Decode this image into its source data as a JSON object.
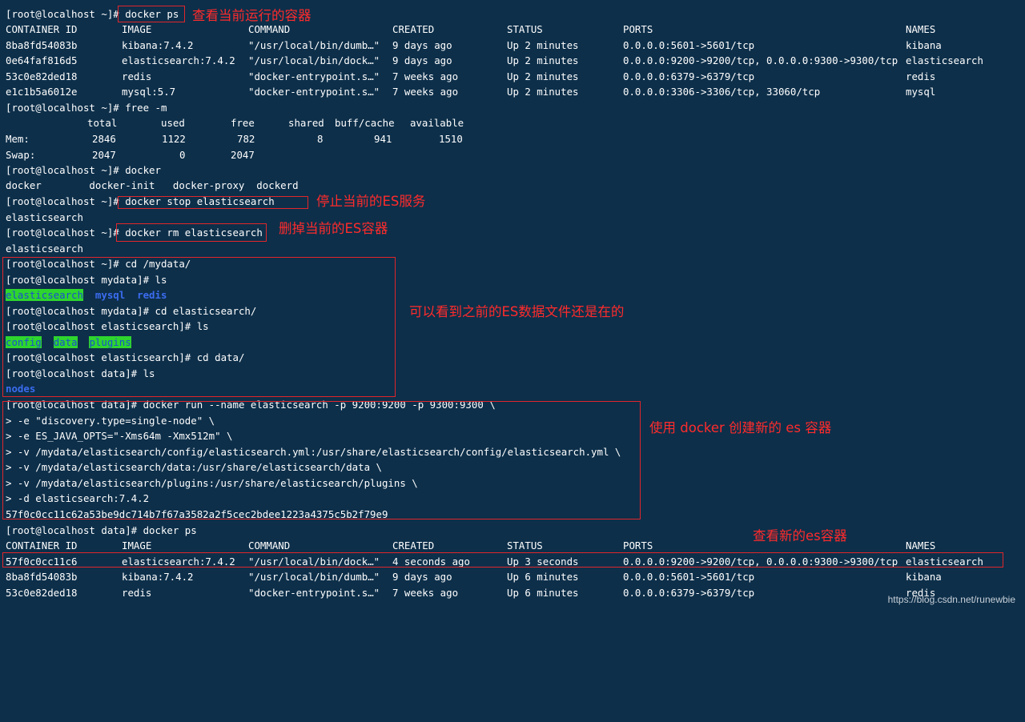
{
  "terminal": {
    "prompt_home": "[root@localhost ~]#",
    "prompt_mydata": "[root@localhost mydata]#",
    "prompt_es": "[root@localhost elasticsearch]#",
    "prompt_data": "[root@localhost data]#",
    "cmd1": " docker ps",
    "cmd_free": " free -m",
    "cmd_docker": " docker",
    "cmd_stop": " docker stop elasticsearch",
    "cmd_rm": " docker rm elasticsearch",
    "cmd_cd_mydata": " cd /mydata/",
    "cmd_ls": " ls",
    "cmd_cd_es": " cd elasticsearch/",
    "cmd_cd_data": " cd data/",
    "cmd_run": " docker run --name elasticsearch -p 9200:9200 -p 9300:9300 \\",
    "run_cont1": "> -e \"discovery.type=single-node\" \\",
    "run_cont2": "> -e ES_JAVA_OPTS=\"-Xms64m -Xmx512m\" \\",
    "run_cont3": "> -v /mydata/elasticsearch/config/elasticsearch.yml:/usr/share/elasticsearch/config/elasticsearch.yml \\",
    "run_cont4": "> -v /mydata/elasticsearch/data:/usr/share/elasticsearch/data \\",
    "run_cont5": "> -v /mydata/elasticsearch/plugins:/usr/share/elasticsearch/plugins \\",
    "run_cont6": "> -d elasticsearch:7.4.2",
    "run_output": "57f0c0cc11c62a53be9dc714b7f67a3582a2f5cec2bdee1223a4375c5b2f79e9",
    "cmd_ps2": " docker ps",
    "out_elasticsearch": "elasticsearch",
    "docker_completions": "docker        docker-init   docker-proxy  dockerd",
    "ls_mydata": [
      "elasticsearch",
      "mysql",
      "redis"
    ],
    "ls_es": [
      "config",
      "data",
      "plugins"
    ],
    "ls_data": "nodes"
  },
  "ps_headers": [
    "CONTAINER ID",
    "IMAGE",
    "COMMAND",
    "CREATED",
    "STATUS",
    "PORTS",
    "NAMES"
  ],
  "ps_table_1": [
    [
      "8ba8fd54083b",
      "kibana:7.4.2",
      "\"/usr/local/bin/dumb…\"",
      "9 days ago",
      "Up 2 minutes",
      "0.0.0.0:5601->5601/tcp",
      "kibana"
    ],
    [
      "0e64faf816d5",
      "elasticsearch:7.4.2",
      "\"/usr/local/bin/dock…\"",
      "9 days ago",
      "Up 2 minutes",
      "0.0.0.0:9200->9200/tcp, 0.0.0.0:9300->9300/tcp",
      "elasticsearch"
    ],
    [
      "53c0e82ded18",
      "redis",
      "\"docker-entrypoint.s…\"",
      "7 weeks ago",
      "Up 2 minutes",
      "0.0.0.0:6379->6379/tcp",
      "redis"
    ],
    [
      "e1c1b5a6012e",
      "mysql:5.7",
      "\"docker-entrypoint.s…\"",
      "7 weeks ago",
      "Up 2 minutes",
      "0.0.0.0:3306->3306/tcp, 33060/tcp",
      "mysql"
    ]
  ],
  "free_table": {
    "header": [
      "total",
      "used",
      "free",
      "shared",
      "buff/cache",
      "available"
    ],
    "rows": [
      [
        "Mem:",
        "2846",
        "1122",
        "782",
        "8",
        "941",
        "1510"
      ],
      [
        "Swap:",
        "2047",
        "0",
        "2047",
        "",
        "",
        ""
      ]
    ]
  },
  "ps_table_2": [
    [
      "57f0c0cc11c6",
      "elasticsearch:7.4.2",
      "\"/usr/local/bin/dock…\"",
      "4 seconds ago",
      "Up 3 seconds",
      "0.0.0.0:9200->9200/tcp, 0.0.0.0:9300->9300/tcp",
      "elasticsearch"
    ],
    [
      "8ba8fd54083b",
      "kibana:7.4.2",
      "\"/usr/local/bin/dumb…\"",
      "9 days ago",
      "Up 6 minutes",
      "0.0.0.0:5601->5601/tcp",
      "kibana"
    ],
    [
      "53c0e82ded18",
      "redis",
      "\"docker-entrypoint.s…\"",
      "7 weeks ago",
      "Up 6 minutes",
      "0.0.0.0:6379->6379/tcp",
      "redis"
    ]
  ],
  "annotations": {
    "view_running": "查看当前运行的容器",
    "stop_es": "停止当前的ES服务",
    "rm_es": "删掉当前的ES容器",
    "data_still_there": "可以看到之前的ES数据文件还是在的",
    "create_new": "使用 docker 创建新的 es 容器",
    "view_new": "查看新的es容器"
  },
  "watermark": "https://blog.csdn.net/runewbie",
  "colors": {
    "background": "#0d2f4a",
    "annotation_red": "#ff2b2b",
    "ls_dir_highlight": "#2ed52e",
    "ls_dir_blue": "#3b6cf0"
  }
}
